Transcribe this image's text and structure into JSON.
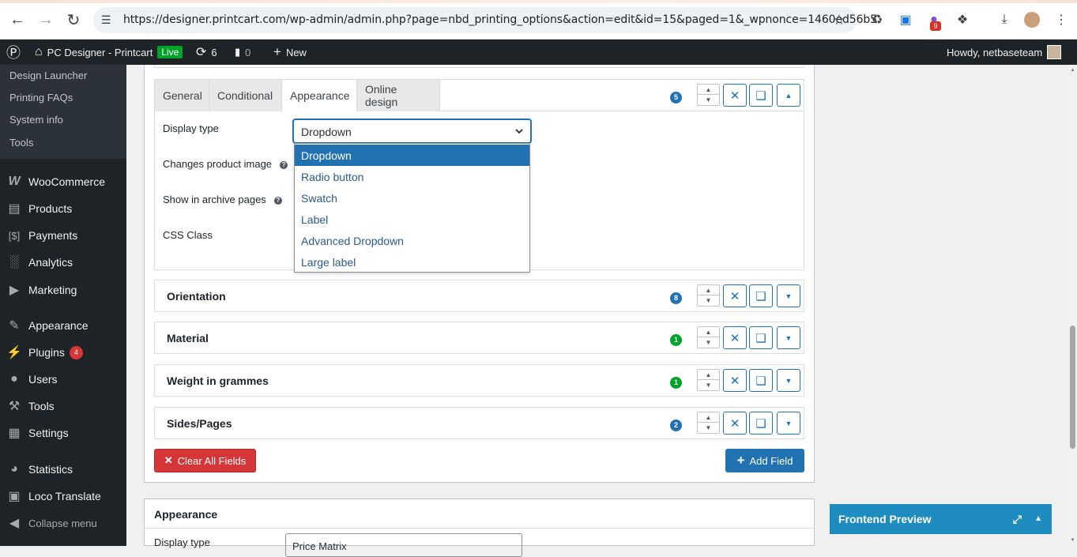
{
  "browser": {
    "url": "https://designer.printcart.com/wp-admin/admin.php?page=nbd_printing_options&action=edit&id=15&paged=1&_wpnonce=1460ed56b5",
    "ext_badge": "9"
  },
  "adminbar": {
    "site_name": "PC Designer - Printcart",
    "live": "Live",
    "updates": "6",
    "comments": "0",
    "new": "New",
    "howdy": "Howdy, netbaseteam"
  },
  "sidebar": {
    "submenu": [
      "Design Launcher",
      "Printing FAQs",
      "System info",
      "Tools"
    ],
    "items": [
      {
        "label": "WooCommerce",
        "icon": "woo-icon"
      },
      {
        "label": "Products",
        "icon": "archive-icon"
      },
      {
        "label": "Payments",
        "icon": "dollar-icon"
      },
      {
        "label": "Analytics",
        "icon": "bar-chart-icon"
      },
      {
        "label": "Marketing",
        "icon": "megaphone-icon"
      },
      {
        "label": "Appearance",
        "icon": "brush-icon"
      },
      {
        "label": "Plugins",
        "icon": "plug-icon",
        "badge": "4"
      },
      {
        "label": "Users",
        "icon": "user-icon"
      },
      {
        "label": "Tools",
        "icon": "wrench-icon"
      },
      {
        "label": "Settings",
        "icon": "settings-icon"
      },
      {
        "label": "Statistics",
        "icon": "pie-icon"
      },
      {
        "label": "Loco Translate",
        "icon": "translate-icon"
      },
      {
        "label": "Collapse menu",
        "icon": "collapse-icon"
      }
    ]
  },
  "option": {
    "tabs": [
      "General",
      "Conditional",
      "Appearance",
      "Online design"
    ],
    "active_tab": "Appearance",
    "count": "5",
    "fields": {
      "display_type": "Display type",
      "changes_image": "Changes product image",
      "show_archive": "Show in archive pages",
      "css_class": "CSS Class"
    },
    "select_value": "Dropdown",
    "dropdown_options": [
      "Dropdown",
      "Radio button",
      "Swatch",
      "Label",
      "Advanced Dropdown",
      "Large label"
    ]
  },
  "rows": [
    {
      "title": "Orientation",
      "count": "8",
      "color": "#2271b1"
    },
    {
      "title": "Material",
      "count": "1",
      "color": "#00a32a"
    },
    {
      "title": "Weight in grammes",
      "count": "1",
      "color": "#00a32a"
    },
    {
      "title": "Sides/Pages",
      "count": "2",
      "color": "#2271b1"
    }
  ],
  "buttons": {
    "clear": "Clear All Fields",
    "add": "Add Field"
  },
  "appearance_panel": {
    "title": "Appearance",
    "display_type": "Display type",
    "value": "Price Matrix"
  },
  "frontend_preview": "Frontend Preview"
}
